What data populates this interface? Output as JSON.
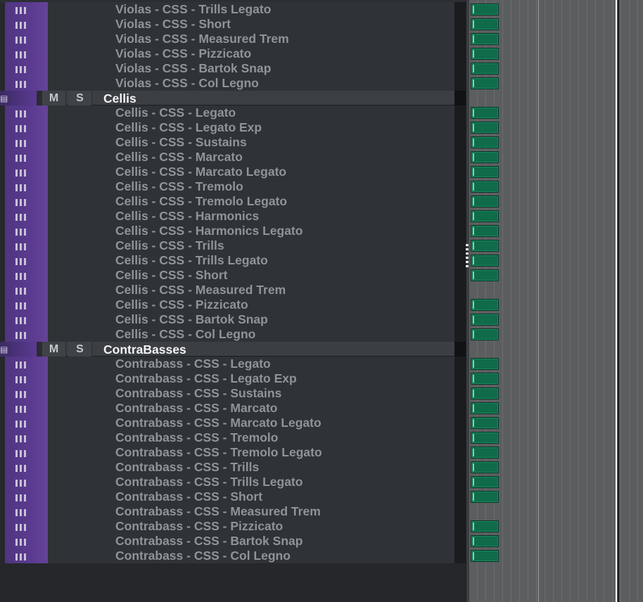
{
  "tracks": [
    {
      "kind": "track",
      "name": "Violas - CSS - Trills Legato",
      "has_event": true
    },
    {
      "kind": "track",
      "name": "Violas - CSS - Short",
      "has_event": true
    },
    {
      "kind": "track",
      "name": "Violas - CSS - Measured Trem",
      "has_event": true
    },
    {
      "kind": "track",
      "name": "Violas - CSS - Pizzicato",
      "has_event": true
    },
    {
      "kind": "track",
      "name": "Violas - CSS - Bartok Snap",
      "has_event": true
    },
    {
      "kind": "track",
      "name": "Violas - CSS - Col Legno",
      "has_event": true
    },
    {
      "kind": "folder",
      "name": "Cellis",
      "mute": "M",
      "solo": "S"
    },
    {
      "kind": "track",
      "name": "Cellis - CSS - Legato",
      "has_event": true
    },
    {
      "kind": "track",
      "name": "Cellis - CSS - Legato Exp",
      "has_event": true
    },
    {
      "kind": "track",
      "name": "Cellis - CSS - Sustains",
      "has_event": true
    },
    {
      "kind": "track",
      "name": "Cellis - CSS - Marcato",
      "has_event": true
    },
    {
      "kind": "track",
      "name": "Cellis - CSS - Marcato Legato",
      "has_event": true
    },
    {
      "kind": "track",
      "name": "Cellis - CSS - Tremolo",
      "has_event": true
    },
    {
      "kind": "track",
      "name": "Cellis - CSS - Tremolo Legato",
      "has_event": true
    },
    {
      "kind": "track",
      "name": "Cellis - CSS - Harmonics",
      "has_event": true
    },
    {
      "kind": "track",
      "name": "Cellis - CSS - Harmonics Legato",
      "has_event": true
    },
    {
      "kind": "track",
      "name": "Cellis - CSS - Trills",
      "has_event": true
    },
    {
      "kind": "track",
      "name": "Cellis - CSS - Trills Legato",
      "has_event": true
    },
    {
      "kind": "track",
      "name": "Cellis - CSS - Short",
      "has_event": true
    },
    {
      "kind": "track",
      "name": "Cellis - CSS - Measured Trem",
      "has_event": false
    },
    {
      "kind": "track",
      "name": "Cellis - CSS - Pizzicato",
      "has_event": true
    },
    {
      "kind": "track",
      "name": "Cellis - CSS - Bartok Snap",
      "has_event": true
    },
    {
      "kind": "track",
      "name": "Cellis - CSS - Col Legno",
      "has_event": true
    },
    {
      "kind": "folder",
      "name": "ContraBasses",
      "mute": "M",
      "solo": "S"
    },
    {
      "kind": "track",
      "name": "Contrabass - CSS - Legato",
      "has_event": true
    },
    {
      "kind": "track",
      "name": "Contrabass - CSS - Legato Exp",
      "has_event": true
    },
    {
      "kind": "track",
      "name": "Contrabass - CSS - Sustains",
      "has_event": true
    },
    {
      "kind": "track",
      "name": "Contrabass - CSS - Marcato",
      "has_event": true
    },
    {
      "kind": "track",
      "name": "Contrabass - CSS - Marcato Legato",
      "has_event": true
    },
    {
      "kind": "track",
      "name": "Contrabass - CSS - Tremolo",
      "has_event": true
    },
    {
      "kind": "track",
      "name": "Contrabass - CSS - Tremolo Legato",
      "has_event": true
    },
    {
      "kind": "track",
      "name": "Contrabass - CSS - Trills",
      "has_event": true
    },
    {
      "kind": "track",
      "name": "Contrabass - CSS - Trills Legato",
      "has_event": true
    },
    {
      "kind": "track",
      "name": "Contrabass - CSS - Short",
      "has_event": true
    },
    {
      "kind": "track",
      "name": "Contrabass - CSS - Measured Trem",
      "has_event": false
    },
    {
      "kind": "track",
      "name": "Contrabass - CSS - Pizzicato",
      "has_event": true
    },
    {
      "kind": "track",
      "name": "Contrabass - CSS - Bartok Snap",
      "has_event": true
    },
    {
      "kind": "track",
      "name": "Contrabass - CSS - Col Legno",
      "has_event": true
    }
  ],
  "colors": {
    "track_color": "#5a3b8f",
    "event_color": "#0f6b4a",
    "folder_name_color": "#f2f2f2",
    "track_name_color": "#8f949a"
  }
}
